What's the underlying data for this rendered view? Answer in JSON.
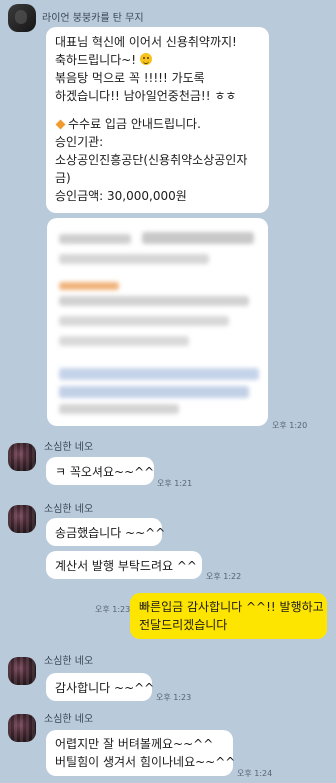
{
  "message1": {
    "sender": "라이언 붕붕카를 탄 무지",
    "lines": [
      "대표님 혁신에 이어서 신용취약까지!",
      "축하드립니다~!",
      "볶음탕 먹으로 꼭 !!!!! 가도록",
      "하겠습니다!! 남아일언중천금!! ㅎㅎ",
      "",
      "수수료 입금 안내드립니다.",
      "승인기관:",
      "소상공인진흥공단(신용취약소상공인자",
      "금)",
      "승인금액: 30,000,000원"
    ],
    "time": "오후 1:20"
  },
  "message2": {
    "sender": "소심한 네오",
    "text": "ㅋ 꼭오셔요~~^^",
    "time": "오후 1:21"
  },
  "message3": {
    "sender": "소심한 네오",
    "text1": "송금했습니다 ~~^^",
    "text2": "계산서 발행 부탁드려요 ^^",
    "time": "오후 1:22"
  },
  "message4": {
    "lines": [
      "빠른입금 감사합니다 ^^!! 발행하고",
      "전달드리겠습니다"
    ],
    "time": "오후 1:23"
  },
  "message5": {
    "sender": "소심한 네오",
    "text": "감사합니다 ~~^^",
    "time": "오후 1:23"
  },
  "message6": {
    "sender": "소심한 네오",
    "lines": [
      "어렵지만 잘 버텨볼께요~~^^",
      "버틸힘이 생겨서 힘이나네요~~^^"
    ],
    "time": "오후 1:24"
  },
  "colors": {
    "background": "#b9cbdb",
    "my_bubble": "#fee500",
    "other_bubble": "#ffffff"
  }
}
